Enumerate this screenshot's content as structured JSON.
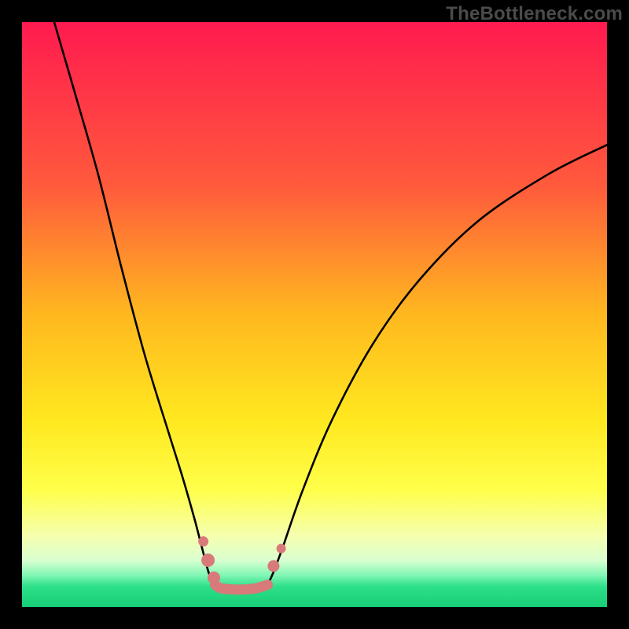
{
  "attribution": "TheBottleneck.com",
  "chart_data": {
    "type": "line",
    "title": "",
    "xlabel": "",
    "ylabel": "",
    "xlim": [
      0,
      100
    ],
    "ylim": [
      0,
      100
    ],
    "gradient_stops": [
      {
        "offset": 0,
        "color": "#ff1a4f"
      },
      {
        "offset": 0.28,
        "color": "#ff5a3c"
      },
      {
        "offset": 0.5,
        "color": "#ffb81f"
      },
      {
        "offset": 0.68,
        "color": "#ffe81f"
      },
      {
        "offset": 0.8,
        "color": "#ffff4a"
      },
      {
        "offset": 0.88,
        "color": "#f5ffb0"
      },
      {
        "offset": 0.92,
        "color": "#d9ffd0"
      },
      {
        "offset": 0.945,
        "color": "#84f7b6"
      },
      {
        "offset": 0.965,
        "color": "#2de089"
      },
      {
        "offset": 1.0,
        "color": "#16ce77"
      }
    ],
    "series": [
      {
        "name": "left-curve",
        "x": [
          5.5,
          9,
          13,
          17,
          21,
          25,
          27.5,
          29.5,
          30.8,
          32,
          33
        ],
        "y": [
          100,
          88,
          74,
          58,
          43,
          30,
          22,
          15,
          10,
          5.6,
          3.8
        ]
      },
      {
        "name": "right-curve",
        "x": [
          42,
          43,
          44.5,
          48,
          53,
          60,
          68,
          78,
          90,
          100
        ],
        "y": [
          3.8,
          6,
          10,
          20,
          32,
          45,
          56,
          66,
          74,
          79
        ]
      },
      {
        "name": "trough-band",
        "x": [
          33,
          34,
          36,
          38,
          40,
          42
        ],
        "y": [
          3.8,
          3.2,
          3.0,
          3.0,
          3.2,
          3.8
        ]
      }
    ],
    "markers": {
      "left_cluster": [
        {
          "x": 31.0,
          "y": 11.2
        },
        {
          "x": 31.8,
          "y": 8.0
        },
        {
          "x": 32.8,
          "y": 5.0
        }
      ],
      "right_cluster": [
        {
          "x": 43.0,
          "y": 7.0
        },
        {
          "x": 44.3,
          "y": 10.0
        }
      ],
      "marker_color": "#d97a7a",
      "trough_color": "#d97a7a"
    }
  }
}
